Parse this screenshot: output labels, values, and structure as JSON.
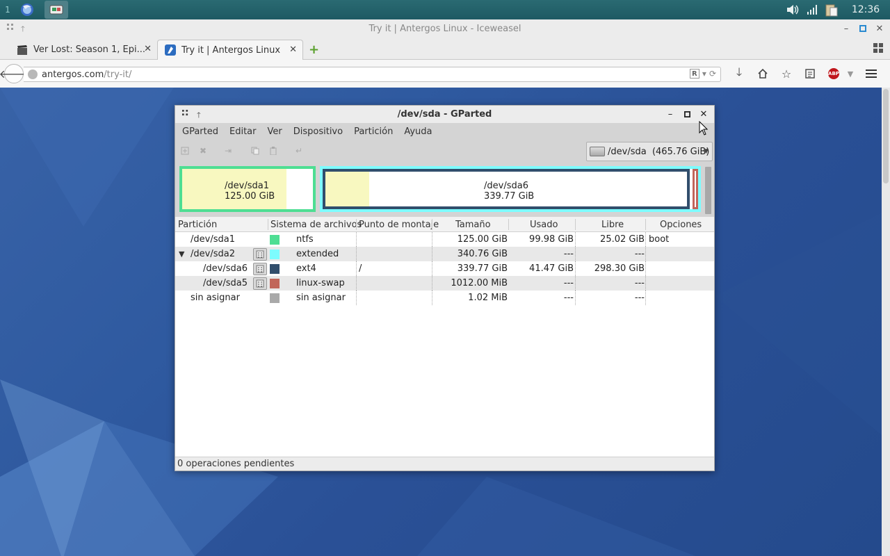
{
  "taskbar": {
    "workspace": "1",
    "clock": "12:36"
  },
  "browser": {
    "window_title": "Try it | Antergos Linux - Iceweasel",
    "tabs": [
      {
        "label": "Ver Lost: Season 1, Epi...",
        "active": false
      },
      {
        "label": "Try it | Antergos Linux",
        "active": true
      }
    ],
    "url_host": "antergos.com",
    "url_path": "/try-it/",
    "abp_label": "ABP"
  },
  "gparted": {
    "window_title": "/dev/sda - GParted",
    "menu": [
      "GParted",
      "Editar",
      "Ver",
      "Dispositivo",
      "Partición",
      "Ayuda"
    ],
    "device_selector": "/dev/sda  (465.76 GiB)",
    "visual": {
      "sda1": {
        "name": "/dev/sda1",
        "size": "125.00 GiB",
        "used_fraction": 0.7998,
        "color": "#4ede93"
      },
      "sda6": {
        "name": "/dev/sda6",
        "size": "339.77 GiB",
        "used_fraction": 0.122,
        "color": "#314e6c"
      },
      "extended_color": "#7dfcfe",
      "swap_color": "#c1665a"
    },
    "columns": [
      "Partición",
      "Sistema de archivos",
      "Punto de montaje",
      "Tamaño",
      "Usado",
      "Libre",
      "Opciones"
    ],
    "rows": [
      {
        "partition": "/dev/sda1",
        "fs": "ntfs",
        "mount": "",
        "size": "125.00 GiB",
        "used": "99.98 GiB",
        "free": "25.02 GiB",
        "options": "boot",
        "color": "#4ede93",
        "locked": false,
        "indent": 0,
        "expander": false
      },
      {
        "partition": "/dev/sda2",
        "fs": "extended",
        "mount": "",
        "size": "340.76 GiB",
        "used": "---",
        "free": "---",
        "options": "",
        "color": "#7dfcfe",
        "locked": true,
        "indent": 0,
        "expander": true
      },
      {
        "partition": "/dev/sda6",
        "fs": "ext4",
        "mount": "/",
        "size": "339.77 GiB",
        "used": "41.47 GiB",
        "free": "298.30 GiB",
        "options": "",
        "color": "#314e6c",
        "locked": true,
        "indent": 1,
        "expander": false
      },
      {
        "partition": "/dev/sda5",
        "fs": "linux-swap",
        "mount": "",
        "size": "1012.00 MiB",
        "used": "---",
        "free": "---",
        "options": "",
        "color": "#c1665a",
        "locked": true,
        "indent": 1,
        "expander": false
      },
      {
        "partition": "sin asignar",
        "fs": "sin asignar",
        "mount": "",
        "size": "1.02 MiB",
        "used": "---",
        "free": "---",
        "options": "",
        "color": "#a9a9a9",
        "locked": false,
        "indent": 0,
        "expander": false
      }
    ],
    "status": "0 operaciones pendientes"
  }
}
